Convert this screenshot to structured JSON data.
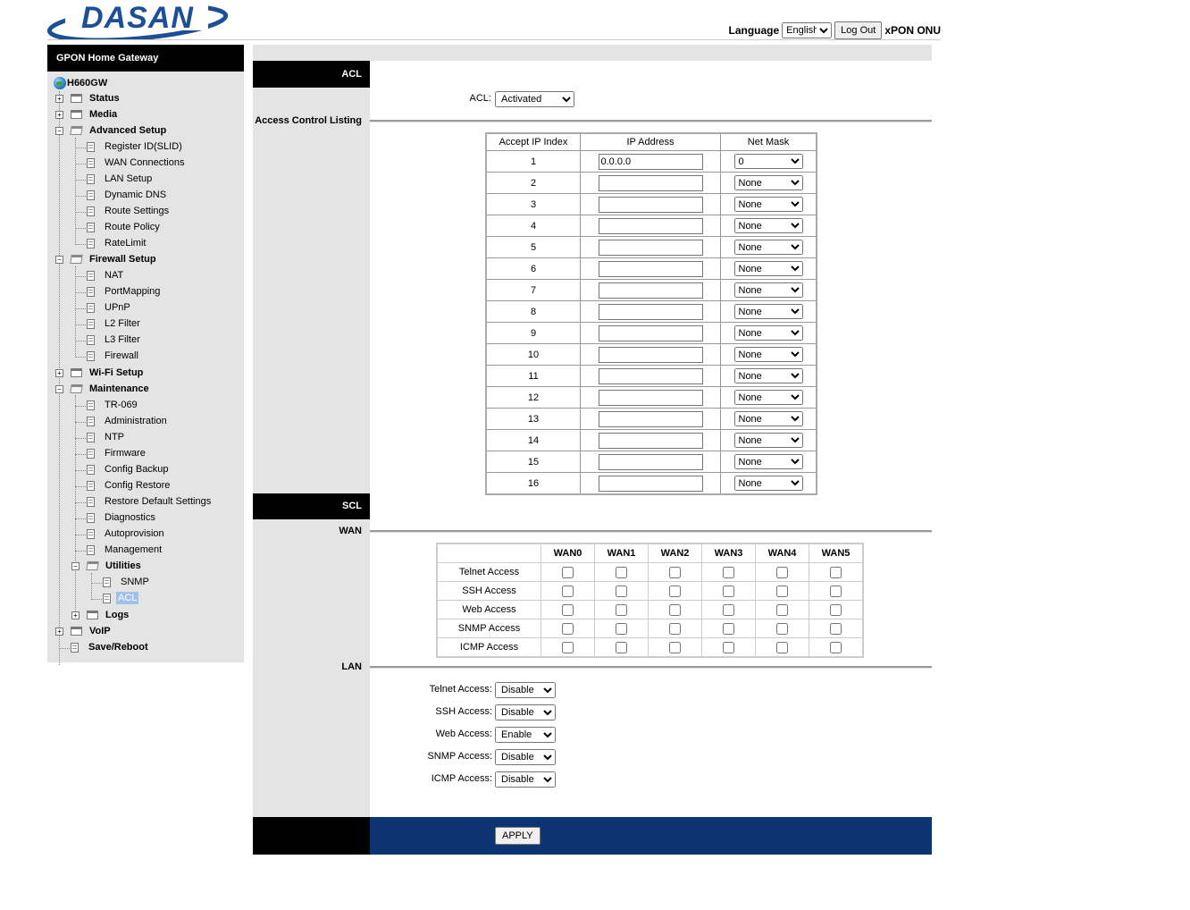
{
  "header": {
    "brand": "DASAN",
    "language_label": "Language",
    "language_value": "English",
    "logout_label": "Log Out",
    "product": "xPON ONU"
  },
  "sidebar": {
    "title": "GPON Home Gateway",
    "root": "H660GW",
    "items": [
      {
        "label": "Status",
        "kind": "folder",
        "state": "collapsed"
      },
      {
        "label": "Media",
        "kind": "folder",
        "state": "collapsed"
      },
      {
        "label": "Advanced Setup",
        "kind": "folder",
        "state": "expanded"
      },
      {
        "label": "Register ID(SLID)",
        "kind": "page"
      },
      {
        "label": "WAN Connections",
        "kind": "page"
      },
      {
        "label": "LAN Setup",
        "kind": "page"
      },
      {
        "label": "Dynamic DNS",
        "kind": "page"
      },
      {
        "label": "Route Settings",
        "kind": "page"
      },
      {
        "label": "Route Policy",
        "kind": "page"
      },
      {
        "label": "RateLimit",
        "kind": "page"
      },
      {
        "label": "Firewall Setup",
        "kind": "folder",
        "state": "expanded"
      },
      {
        "label": "NAT",
        "kind": "page"
      },
      {
        "label": "PortMapping",
        "kind": "page"
      },
      {
        "label": "UPnP",
        "kind": "page"
      },
      {
        "label": "L2 Filter",
        "kind": "page"
      },
      {
        "label": "L3 Filter",
        "kind": "page"
      },
      {
        "label": "Firewall",
        "kind": "page"
      },
      {
        "label": "Wi-Fi Setup",
        "kind": "folder",
        "state": "collapsed"
      },
      {
        "label": "Maintenance",
        "kind": "folder",
        "state": "expanded"
      },
      {
        "label": "TR-069",
        "kind": "page"
      },
      {
        "label": "Administration",
        "kind": "page"
      },
      {
        "label": "NTP",
        "kind": "page"
      },
      {
        "label": "Firmware",
        "kind": "page"
      },
      {
        "label": "Config Backup",
        "kind": "page"
      },
      {
        "label": "Config Restore",
        "kind": "page"
      },
      {
        "label": "Restore Default Settings",
        "kind": "page"
      },
      {
        "label": "Diagnostics",
        "kind": "page"
      },
      {
        "label": "Autoprovision",
        "kind": "page"
      },
      {
        "label": "Management",
        "kind": "page"
      },
      {
        "label": "Utilities",
        "kind": "folder",
        "state": "expanded"
      },
      {
        "label": "SNMP",
        "kind": "page"
      },
      {
        "label": "ACL",
        "kind": "page",
        "selected": true
      },
      {
        "label": "Logs",
        "kind": "folder",
        "state": "collapsed"
      },
      {
        "label": "VoIP",
        "kind": "folder",
        "state": "collapsed"
      },
      {
        "label": "Save/Reboot",
        "kind": "page"
      }
    ]
  },
  "acl": {
    "section_label": "ACL",
    "field_label": "ACL:",
    "field_value": "Activated",
    "listing_label": "Access Control Listing",
    "columns": [
      "Accept IP Index",
      "IP Address",
      "Net Mask"
    ],
    "rows": [
      {
        "index": "1",
        "ip": "0.0.0.0",
        "mask": "0"
      },
      {
        "index": "2",
        "ip": "",
        "mask": "None"
      },
      {
        "index": "3",
        "ip": "",
        "mask": "None"
      },
      {
        "index": "4",
        "ip": "",
        "mask": "None"
      },
      {
        "index": "5",
        "ip": "",
        "mask": "None"
      },
      {
        "index": "6",
        "ip": "",
        "mask": "None"
      },
      {
        "index": "7",
        "ip": "",
        "mask": "None"
      },
      {
        "index": "8",
        "ip": "",
        "mask": "None"
      },
      {
        "index": "9",
        "ip": "",
        "mask": "None"
      },
      {
        "index": "10",
        "ip": "",
        "mask": "None"
      },
      {
        "index": "11",
        "ip": "",
        "mask": "None"
      },
      {
        "index": "12",
        "ip": "",
        "mask": "None"
      },
      {
        "index": "13",
        "ip": "",
        "mask": "None"
      },
      {
        "index": "14",
        "ip": "",
        "mask": "None"
      },
      {
        "index": "15",
        "ip": "",
        "mask": "None"
      },
      {
        "index": "16",
        "ip": "",
        "mask": "None"
      }
    ]
  },
  "scl": {
    "section_label": "SCL",
    "wan_label": "WAN",
    "wan_columns": [
      "WAN0",
      "WAN1",
      "WAN2",
      "WAN3",
      "WAN4",
      "WAN5"
    ],
    "wan_rows": [
      {
        "label": "Telnet Access",
        "checked": [
          false,
          false,
          false,
          false,
          false,
          false
        ]
      },
      {
        "label": "SSH Access",
        "checked": [
          false,
          false,
          false,
          false,
          false,
          false
        ]
      },
      {
        "label": "Web Access",
        "checked": [
          false,
          false,
          false,
          false,
          false,
          false
        ]
      },
      {
        "label": "SNMP Access",
        "checked": [
          false,
          false,
          false,
          false,
          false,
          false
        ]
      },
      {
        "label": "ICMP Access",
        "checked": [
          false,
          false,
          false,
          false,
          false,
          false
        ]
      }
    ],
    "lan_label": "LAN",
    "lan_fields": [
      {
        "label": "Telnet Access:",
        "value": "Disable"
      },
      {
        "label": "SSH Access:",
        "value": "Disable"
      },
      {
        "label": "Web Access:",
        "value": "Enable"
      },
      {
        "label": "SNMP Access:",
        "value": "Disable"
      },
      {
        "label": "ICMP Access:",
        "value": "Disable"
      }
    ]
  },
  "apply_label": "APPLY",
  "colors": {
    "logo_blue": "#1c4f97",
    "apply_bar": "#0c3472",
    "panel_gray": "#e4e4e4",
    "section_black": "#000000",
    "selected_highlight": "#9ec2ec"
  }
}
